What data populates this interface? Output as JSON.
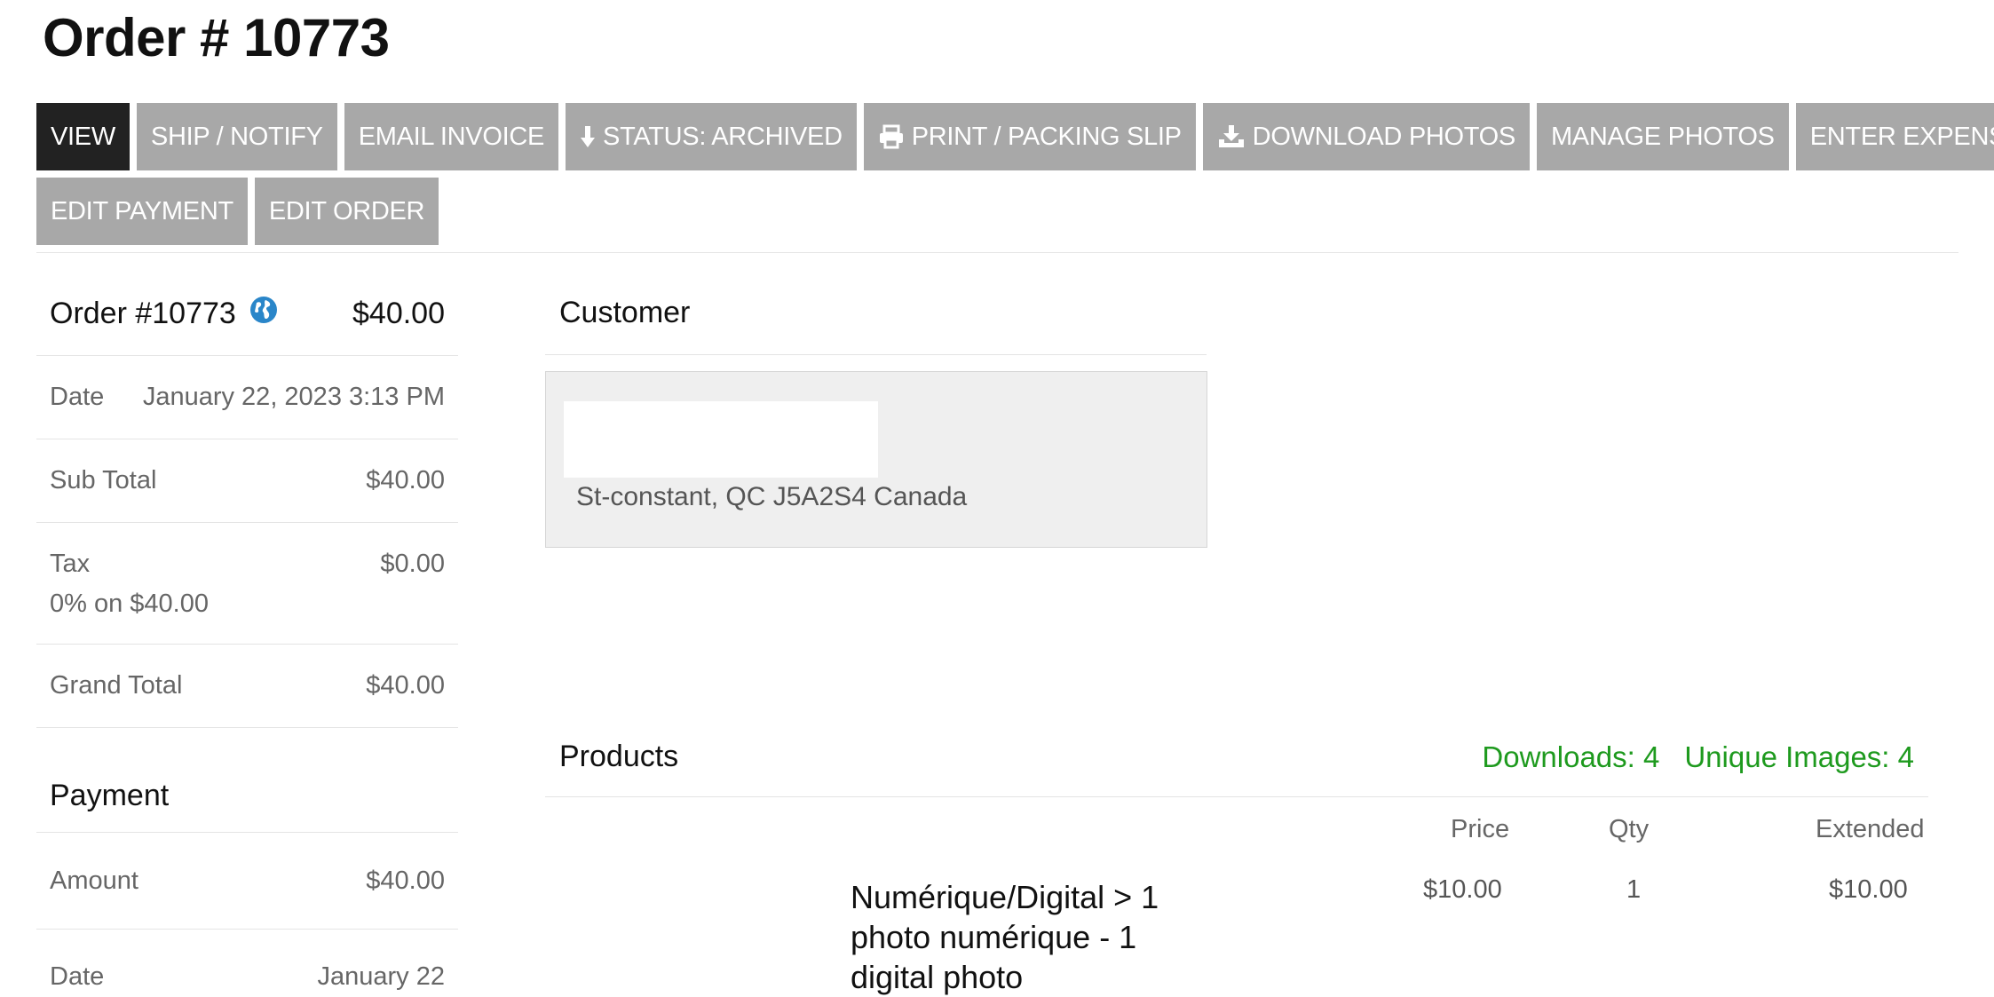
{
  "page": {
    "title": "Order # 10773"
  },
  "toolbar": {
    "row1": [
      {
        "label": "VIEW",
        "icon": "",
        "active": true,
        "name": "view-button"
      },
      {
        "label": "SHIP / NOTIFY",
        "icon": "",
        "active": false,
        "name": "ship-notify-button"
      },
      {
        "label": "EMAIL INVOICE",
        "icon": "",
        "active": false,
        "name": "email-invoice-button"
      },
      {
        "label": "STATUS: ARCHIVED",
        "icon": "arrow-down-icon",
        "active": false,
        "name": "status-archived-button"
      },
      {
        "label": "PRINT / PACKING SLIP",
        "icon": "printer-icon",
        "active": false,
        "name": "print-packing-slip-button"
      },
      {
        "label": "DOWNLOAD PHOTOS",
        "icon": "download-icon",
        "active": false,
        "name": "download-photos-button"
      },
      {
        "label": "MANAGE PHOTOS",
        "icon": "",
        "active": false,
        "name": "manage-photos-button"
      },
      {
        "label": "ENTER EXPENSE",
        "icon": "",
        "active": false,
        "name": "enter-expense-button"
      }
    ],
    "row2": [
      {
        "label": "EDIT PAYMENT",
        "icon": "",
        "active": false,
        "name": "edit-payment-button"
      },
      {
        "label": "EDIT ORDER",
        "icon": "",
        "active": false,
        "name": "edit-order-button"
      }
    ]
  },
  "summary": {
    "order_label": "Order #10773",
    "order_icon": "globe-icon",
    "order_total": "$40.00",
    "date_label": "Date",
    "date_value": "January 22, 2023 3:13 PM",
    "subtotal_label": "Sub Total",
    "subtotal_value": "$40.00",
    "tax_label": "Tax",
    "tax_note": "0% on $40.00",
    "tax_value": "$0.00",
    "grand_label": "Grand Total",
    "grand_value": "$40.00"
  },
  "payment": {
    "title": "Payment",
    "amount_label": "Amount",
    "amount_value": "$40.00",
    "date_label": "Date",
    "date_value": "January 22"
  },
  "customer": {
    "title": "Customer",
    "address": "St-constant, QC J5A2S4 Canada"
  },
  "products": {
    "title": "Products",
    "downloads": "Downloads: 4",
    "unique_images": "Unique Images: 4",
    "columns": {
      "price": "Price",
      "qty": "Qty",
      "extended": "Extended"
    },
    "items": [
      {
        "name": "Numérique/Digital > 1 photo numérique - 1 digital photo",
        "price": "$10.00",
        "qty": "1",
        "extended": "$10.00"
      }
    ]
  },
  "colors": {
    "button_bg": "#a8a8a8",
    "button_active_bg": "#222222",
    "stats_green": "#1e9a1e",
    "globe_blue": "#2a86c9"
  }
}
